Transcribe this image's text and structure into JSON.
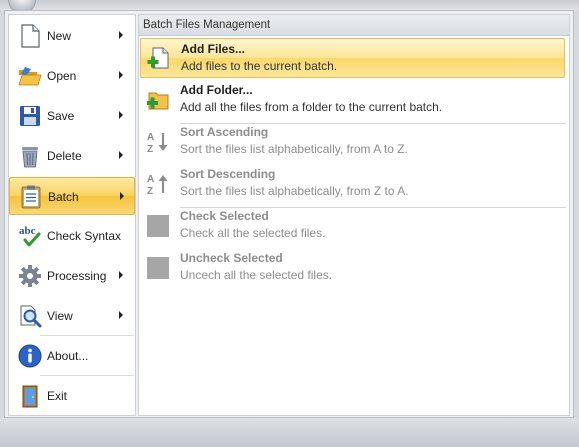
{
  "left_menu": {
    "items": [
      {
        "label": "New",
        "icon": "new-document-icon",
        "has_submenu": true
      },
      {
        "label": "Open",
        "icon": "open-folder-icon",
        "has_submenu": true
      },
      {
        "label": "Save",
        "icon": "save-floppy-icon",
        "has_submenu": true
      },
      {
        "label": "Delete",
        "icon": "trash-can-icon",
        "has_submenu": true
      },
      {
        "label": "Batch",
        "icon": "clipboard-list-icon",
        "has_submenu": true,
        "selected": true
      },
      {
        "label": "Check Syntax",
        "icon": "spellcheck-abc-icon",
        "has_submenu": false
      },
      {
        "label": "Processing",
        "icon": "gear-icon",
        "has_submenu": true
      },
      {
        "label": "View",
        "icon": "magnifier-icon",
        "has_submenu": true
      },
      {
        "label": "About...",
        "icon": "info-icon",
        "has_submenu": false
      },
      {
        "label": "Exit",
        "icon": "exit-door-icon",
        "has_submenu": false
      }
    ]
  },
  "submenu": {
    "header": "Batch Files Management",
    "items": [
      {
        "title": "Add Files...",
        "description": "Add files to the current batch.",
        "icon": "add-file-icon",
        "enabled": true,
        "highlighted": true
      },
      {
        "title": "Add Folder...",
        "description": "Add all the files from a folder to the current batch.",
        "icon": "add-folder-icon",
        "enabled": true
      },
      {
        "title": "Sort Ascending",
        "description": "Sort the files list alphabetically, from A to Z.",
        "icon": "sort-ascending-icon",
        "enabled": false
      },
      {
        "title": "Sort Descending",
        "description": "Sort the files list alphabetically, from Z to A.",
        "icon": "sort-descending-icon",
        "enabled": false
      },
      {
        "title": "Check Selected",
        "description": "Check all the selected files.",
        "icon": "check-selected-icon",
        "enabled": false
      },
      {
        "title": "Uncheck Selected",
        "description": "Uncech all the selected files.",
        "icon": "uncheck-selected-icon",
        "enabled": false
      }
    ]
  },
  "colors": {
    "highlight": "#f9d463",
    "highlight_border": "#e3b44c",
    "disabled_text": "#8c8c8c",
    "frame": "#eef0f3"
  }
}
